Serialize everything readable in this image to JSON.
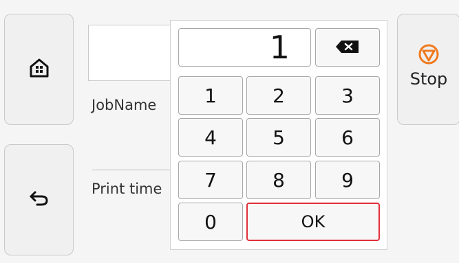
{
  "side": {
    "home_icon": "home-icon",
    "back_icon": "back-arrow-icon"
  },
  "stop": {
    "label": "Stop",
    "icon": "stop-icon",
    "accent": "#f07a1e"
  },
  "job": {
    "name_label": "JobName",
    "print_time_label": "Print time"
  },
  "keypad": {
    "display_value": "1",
    "backspace_icon": "backspace-icon",
    "keys": [
      "1",
      "2",
      "3",
      "4",
      "5",
      "6",
      "7",
      "8",
      "9",
      "0"
    ],
    "ok_label": "OK",
    "ok_border_color": "#e0303a"
  }
}
